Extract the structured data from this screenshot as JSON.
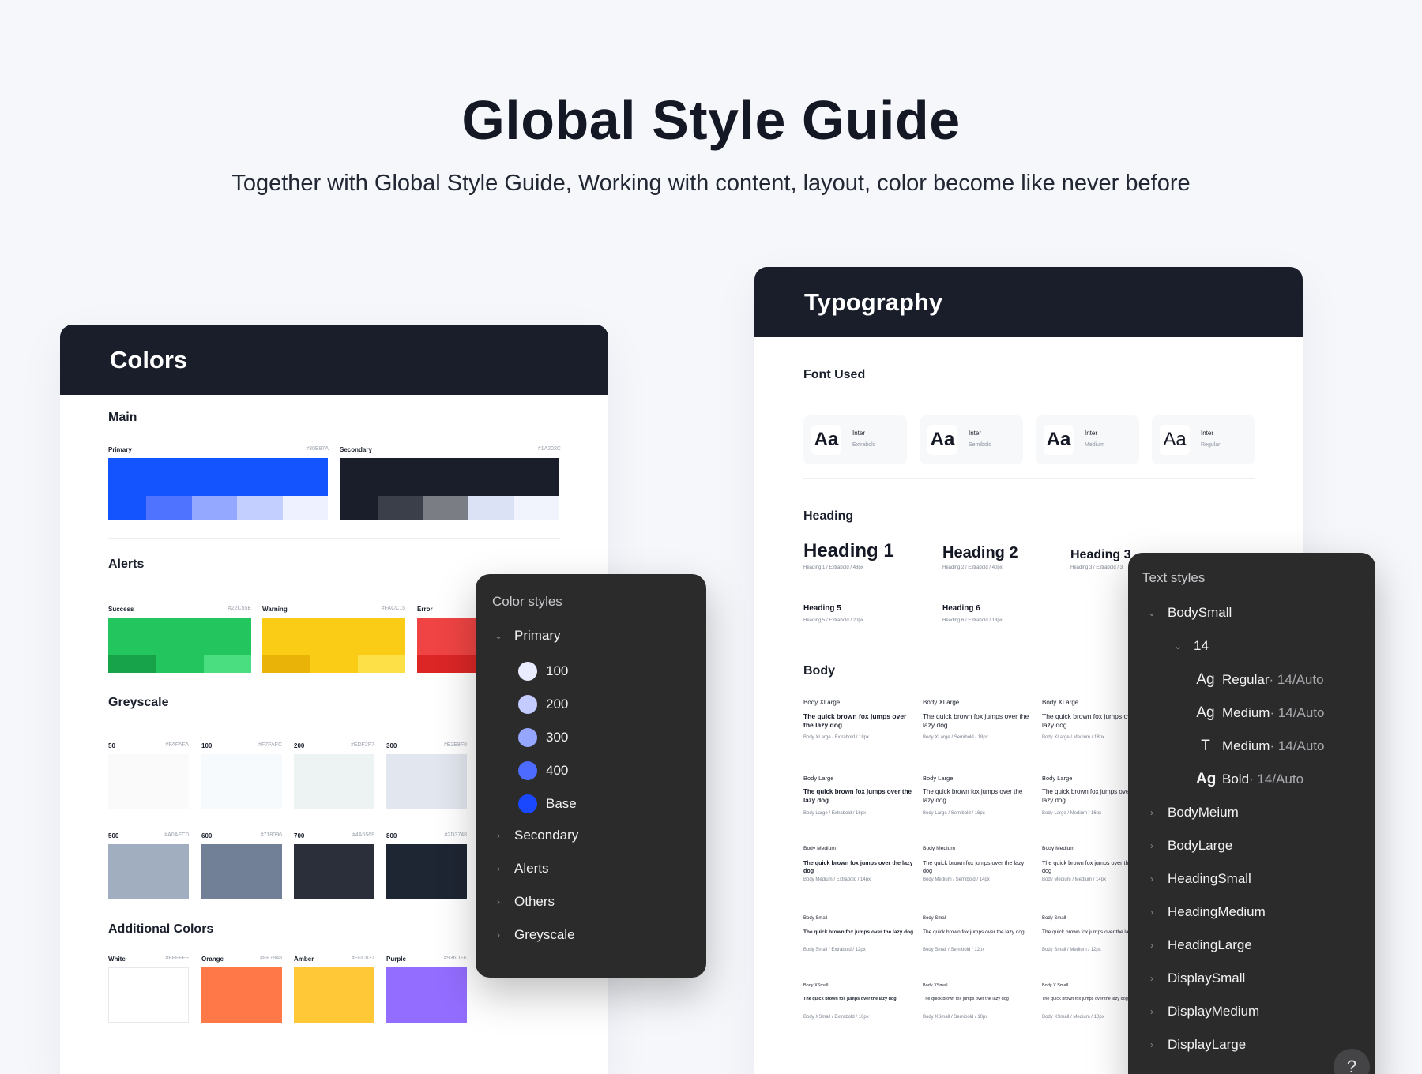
{
  "hero": {
    "title": "Global Style Guide",
    "subtitle": "Together with Global Style Guide, Working with content, layout, color become like never before"
  },
  "colors": {
    "title": "Colors",
    "main_label": "Main",
    "primary": {
      "label": "Primary",
      "hex": "#30E87A",
      "color": "#1454ff",
      "steps": [
        "#1454ff",
        "#4f73ff",
        "#94a8ff",
        "#c3cfff",
        "#eef1ff"
      ]
    },
    "secondary": {
      "label": "Secondary",
      "hex": "#1A202C",
      "color": "#1a1e2b",
      "steps": [
        "#1a1e2b",
        "#3a3f4a",
        "#7a7d84",
        "#dce2f5",
        "#f2f4fd"
      ]
    },
    "alerts_label": "Alerts",
    "success": {
      "label": "Success",
      "hex": "#22C55E",
      "color": "#22c55e",
      "steps": [
        "#17a34a",
        "#22c55e",
        "#4ade80"
      ]
    },
    "warning": {
      "label": "Warning",
      "hex": "#FACC15",
      "color": "#facc15",
      "steps": [
        "#eab308",
        "#facc15",
        "#fde047"
      ]
    },
    "error": {
      "label": "Error",
      "color": "#f04444",
      "steps": [
        "#dc2626",
        "#f04444"
      ]
    },
    "greyscale_label": "Greyscale",
    "greys": [
      {
        "label": "50",
        "hex": "#FAFAFA",
        "color": "#fafafa"
      },
      {
        "label": "100",
        "hex": "#F7FAFC",
        "color": "#f7fafc"
      },
      {
        "label": "200",
        "hex": "#EDF2F7",
        "color": "#edf2f3"
      },
      {
        "label": "300",
        "hex": "#E2E8F0",
        "color": "#e2e6ee"
      },
      {
        "label": "500",
        "hex": "#A0AEC0",
        "color": "#a0aec0"
      },
      {
        "label": "600",
        "hex": "#718096",
        "color": "#718096"
      },
      {
        "label": "700",
        "hex": "#4A5568",
        "color": "#2a2f3a"
      },
      {
        "label": "800",
        "hex": "#2D3748",
        "color": "#1f2633"
      }
    ],
    "additional_label": "Additional Colors",
    "additional": [
      {
        "label": "White",
        "hex": "#FFFFFF",
        "color": "#ffffff"
      },
      {
        "label": "Orange",
        "hex": "#FF7848",
        "color": "#ff7848"
      },
      {
        "label": "Amber",
        "hex": "#FFC837",
        "color": "#ffc837"
      },
      {
        "label": "Purple",
        "hex": "#936DFF",
        "color": "#936dff"
      }
    ]
  },
  "color_styles": {
    "title": "Color styles",
    "primary": "Primary",
    "shades": [
      {
        "label": "100",
        "color": "#e9ecff"
      },
      {
        "label": "200",
        "color": "#c3cbff"
      },
      {
        "label": "300",
        "color": "#95a6ff"
      },
      {
        "label": "400",
        "color": "#4d6bff"
      },
      {
        "label": "Base",
        "color": "#1a48ff"
      }
    ],
    "groups": [
      "Secondary",
      "Alerts",
      "Others",
      "Greyscale"
    ]
  },
  "typography": {
    "title": "Typography",
    "font_used_label": "Font Used",
    "fonts": [
      {
        "aa": "Aa",
        "name": "Inter",
        "weight": "Extrabold"
      },
      {
        "aa": "Aa",
        "name": "Inter",
        "weight": "Semibold"
      },
      {
        "aa": "Aa",
        "name": "Inter",
        "weight": "Medium"
      },
      {
        "aa": "Aa",
        "name": "Inter",
        "weight": "Regular"
      }
    ],
    "heading_label": "Heading",
    "headings": [
      {
        "text": "Heading 1",
        "meta": "Heading 1 / Extrabold / 48px"
      },
      {
        "text": "Heading 2",
        "meta": "Heading 2 / Extrabold / 40px"
      },
      {
        "text": "Heading 3",
        "meta": "Heading 3 / Extrabold / 3"
      },
      {
        "text": "Heading 5",
        "meta": "Heading 5 / Extrabold / 20px"
      },
      {
        "text": "Heading 6",
        "meta": "Heading 6 / Extrabold / 18px"
      }
    ],
    "body_label": "Body",
    "body_rows": [
      {
        "items": [
          {
            "title": "Body XLarge",
            "text": "The quick brown fox jumps over the lazy dog",
            "meta": "Body XLarge / Extrabold / 18px"
          },
          {
            "title": "Body XLarge",
            "text": "The quick brown fox jumps over the lazy dog",
            "meta": "Body XLarge / Semibold / 18px"
          },
          {
            "title": "Body XLarge",
            "text": "The quick brown fox jumps over the lazy dog",
            "meta": "Body XLarge / Medium / 18px"
          }
        ]
      },
      {
        "items": [
          {
            "title": "Body Large",
            "text": "The quick brown fox jumps over the lazy dog",
            "meta": "Body Large / Extrabold / 16px"
          },
          {
            "title": "Body Large",
            "text": "The quick brown fox jumps over the lazy dog",
            "meta": "Body Large / Semibold / 16px"
          },
          {
            "title": "Body Large",
            "text": "The quick brown fox jumps over the lazy dog",
            "meta": "Body Large / Medium / 16px"
          }
        ]
      },
      {
        "items": [
          {
            "title": "Body Medium",
            "text": "The quick brown fox jumps over the lazy dog",
            "meta": "Body Medium / Extrabold / 14px"
          },
          {
            "title": "Body Medium",
            "text": "The quick brown fox jumps over the lazy dog",
            "meta": "Body Medium / Semibold / 14px"
          },
          {
            "title": "Body Medium",
            "text": "The quick brown fox jumps over the lazy dog",
            "meta": "Body Medium / Medium / 14px"
          }
        ]
      },
      {
        "items": [
          {
            "title": "Body Small",
            "text": "The quick brown fox jumps over the lazy dog",
            "meta": "Body Small / Extrabold / 12px"
          },
          {
            "title": "Body Small",
            "text": "The quick brown fox jumps over the lazy dog",
            "meta": "Body Small / Semibold / 12px"
          },
          {
            "title": "Body Small",
            "text": "The quick brown fox jumps over the lazy dog",
            "meta": "Body Small / Medium / 12px"
          }
        ]
      },
      {
        "items": [
          {
            "title": "Body XSmall",
            "text": "The quick brown fox jumps over the lazy dog",
            "meta": "Body XSmall / Extrabold / 10px"
          },
          {
            "title": "Body XSmall",
            "text": "The quick brown fox jumps over the lazy dog",
            "meta": "Body XSmall / Semibold / 10px"
          },
          {
            "title": "Body X Small",
            "text": "The quick brown fox jumps over the lazy dog",
            "meta": "Body XSmall / Medium / 10px"
          }
        ]
      }
    ]
  },
  "text_styles": {
    "title": "Text styles",
    "expanded": "BodySmall",
    "size": "14",
    "styles": [
      {
        "icon": "Ag",
        "name": "Regular",
        "meta": " · 14/Auto"
      },
      {
        "icon": "Ag",
        "name": "Medium",
        "meta": " · 14/Auto"
      },
      {
        "icon": "T",
        "name": "Medium",
        "meta": " · 14/Auto"
      },
      {
        "icon": "Ag",
        "name": "Bold",
        "meta": " · 14/Auto"
      }
    ],
    "groups": [
      "BodyMeium",
      "BodyLarge",
      "HeadingSmall",
      "HeadingMedium",
      "HeadingLarge",
      "DisplaySmall",
      "DisplayMedium",
      "DisplayLarge"
    ],
    "help": "?"
  }
}
